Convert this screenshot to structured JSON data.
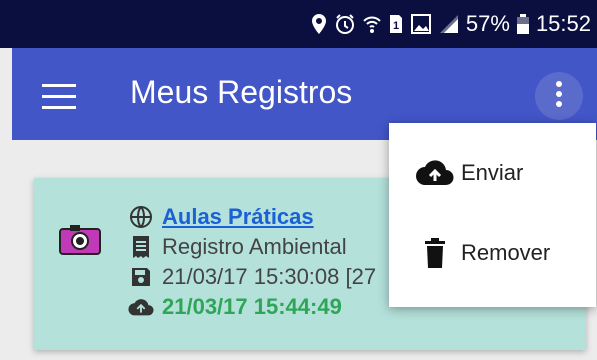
{
  "status_bar": {
    "battery": "57%",
    "time": "15:52",
    "icons": [
      "location-icon",
      "alarm-icon",
      "wifi-icon",
      "sim-icon",
      "image-icon",
      "signal-icon",
      "battery-icon"
    ]
  },
  "app_bar": {
    "title": "Meus Registros",
    "menu_icon": "hamburger-menu-icon",
    "more_icon": "more-vertical-icon",
    "color": "#4256c8"
  },
  "card": {
    "background": "#b4e1da",
    "icon": "camera-icon",
    "link_text": "Aulas Práticas",
    "type_text": "Registro Ambiental",
    "saved_text": "21/03/17 15:30:08 [27",
    "uploaded_text": "21/03/17 15:44:49"
  },
  "menu": {
    "items": [
      {
        "label": "Enviar",
        "icon": "cloud-upload-icon"
      },
      {
        "label": "Remover",
        "icon": "trash-icon"
      }
    ]
  }
}
